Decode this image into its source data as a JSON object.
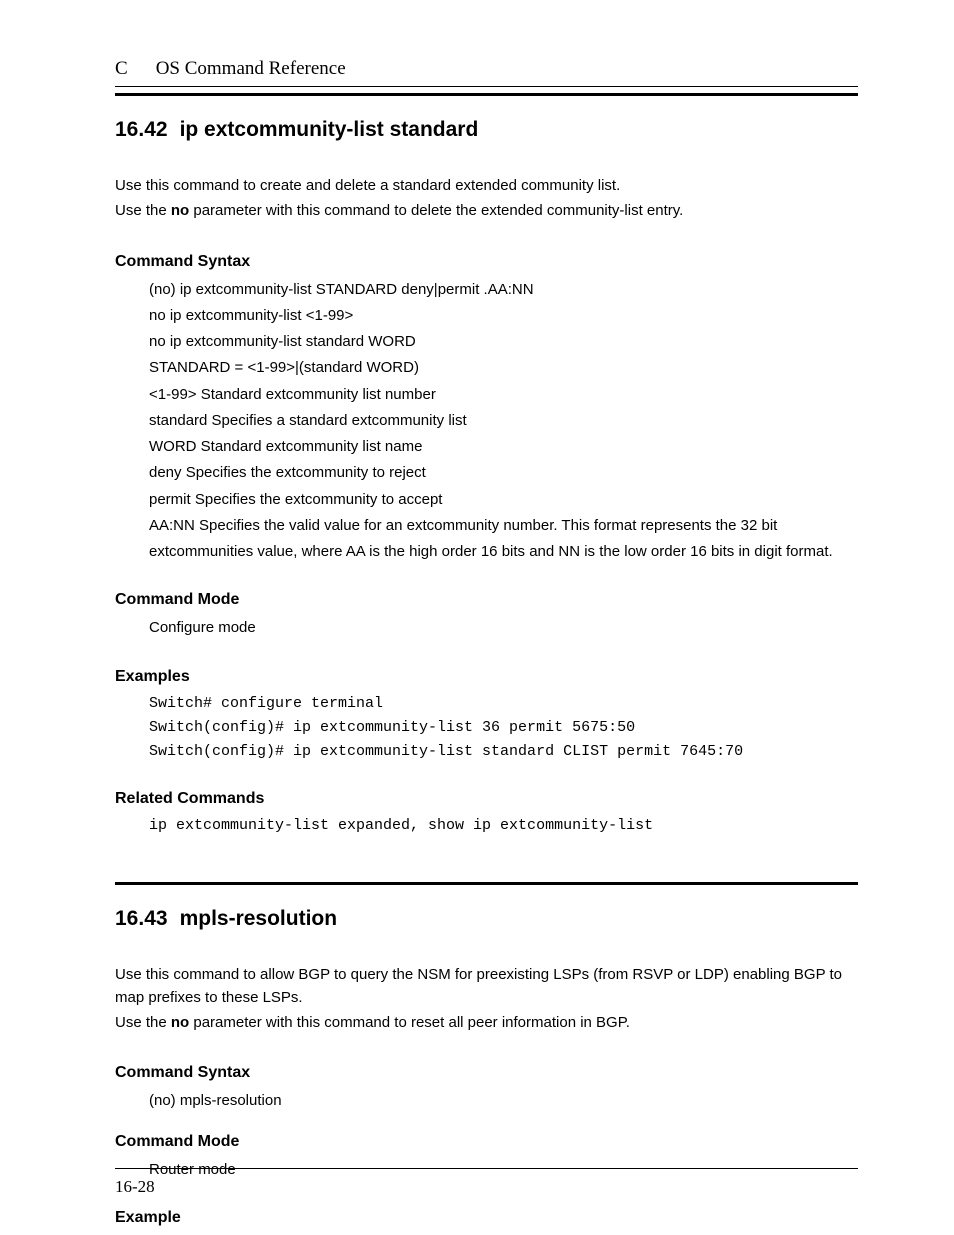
{
  "header": {
    "chapter_letter": "C",
    "chapter_title": "OS Command Reference"
  },
  "section1": {
    "number": "16.42",
    "title": "ip extcommunity-list standard",
    "intro_line1": "Use this command to create and delete a standard extended community list.",
    "intro_line2_pre": "Use the ",
    "intro_line2_bold": "no",
    "intro_line2_post": " parameter with this command to delete the extended community-list entry.",
    "syntax_heading": "Command Syntax",
    "syntax_lines": [
      "(no) ip extcommunity-list STANDARD deny|permit .AA:NN",
      "no ip extcommunity-list <1-99>",
      "no ip extcommunity-list standard WORD",
      "STANDARD = <1-99>|(standard WORD)",
      "<1-99> Standard extcommunity list number",
      "standard Specifies a standard extcommunity list",
      "WORD Standard extcommunity list name",
      "deny Specifies the extcommunity to reject",
      "permit Specifies the extcommunity to accept",
      "AA:NN Specifies the valid value for an extcommunity number. This format represents the 32 bit extcommunities value, where AA is the high order 16 bits and NN is the low order 16 bits in digit format."
    ],
    "mode_heading": "Command Mode",
    "mode_text": "Configure mode",
    "examples_heading": "Examples",
    "examples_lines": [
      "Switch# configure terminal",
      "Switch(config)# ip extcommunity-list 36 permit 5675:50",
      "Switch(config)# ip extcommunity-list standard CLIST permit 7645:70"
    ],
    "related_heading": "Related Commands",
    "related_text": "ip extcommunity-list expanded, show ip extcommunity-list"
  },
  "section2": {
    "number": "16.43",
    "title": "mpls-resolution",
    "intro_line1": "Use this command to allow BGP to query the NSM for preexisting LSPs (from RSVP or LDP) enabling BGP to map prefixes to these LSPs.",
    "intro_line2_pre": "Use the ",
    "intro_line2_bold": "no",
    "intro_line2_post": " parameter with this command to reset all peer information in BGP.",
    "syntax_heading": "Command Syntax",
    "syntax_text": "(no) mpls-resolution",
    "mode_heading": "Command Mode",
    "mode_text": "Router mode",
    "example_heading": "Example"
  },
  "footer": {
    "page_number": "16-28"
  }
}
